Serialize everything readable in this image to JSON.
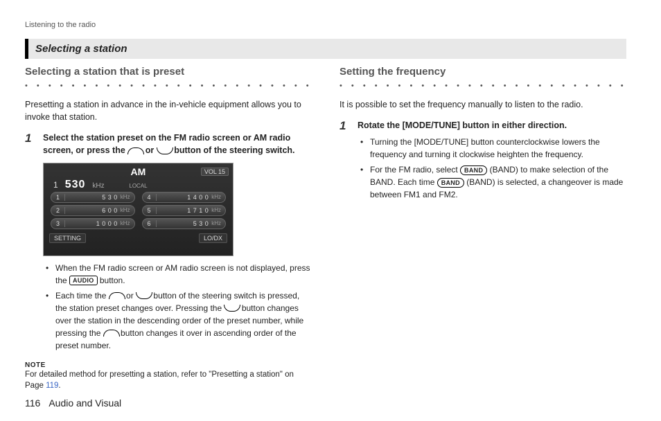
{
  "breadcrumb": "Listening to the radio",
  "section_title": "Selecting a station",
  "left": {
    "subheading": "Selecting a station that is preset",
    "intro": "Presetting a station in advance in the in-vehicle equipment allows you to invoke that station.",
    "step_num": "1",
    "step_a": "Select the station preset on the FM radio screen or AM radio screen, or press the ",
    "step_b": " or ",
    "step_c": " button of the steering switch.",
    "bullet1_a": "When the FM radio screen or AM radio screen is not displayed, press the ",
    "bullet1_b": " button.",
    "bullet2_a": "Each time the ",
    "bullet2_b": " or ",
    "bullet2_c": " button of the steering switch is pressed, the station preset changes over. Pressing the ",
    "bullet2_d": " button changes over the station in the descending order of the preset number, while pressing the ",
    "bullet2_e": " button changes it over in ascending order of the preset number.",
    "note_label": "NOTE",
    "note_a": "For detailed method for presetting a station, refer to \"Presetting a station\" on Page ",
    "note_page": "119",
    "note_b": "."
  },
  "right": {
    "subheading": "Setting the frequency",
    "intro": "It is possible to set the frequency manually to listen to the radio.",
    "step_num": "1",
    "step_text": "Rotate the [MODE/TUNE] button in either direction.",
    "bullet1": "Turning the [MODE/TUNE] button counterclockwise lowers the frequency and turning it clockwise heighten the frequency.",
    "bullet2_a": "For the FM radio, select ",
    "bullet2_b": " (BAND) to make selection of the BAND. Each time ",
    "bullet2_c": " (BAND) is selected, a changeover is made between FM1 and FM2."
  },
  "icons": {
    "audio_label": "AUDIO",
    "band_label": "BAND"
  },
  "radio": {
    "band": "AM",
    "vol": "VOL 15",
    "current_num": "1",
    "current_freq": "530",
    "current_unit": "kHz",
    "local": "LOCAL",
    "presets": [
      {
        "n": "1",
        "f": "5 3 0",
        "u": "kHz"
      },
      {
        "n": "4",
        "f": "1 4 0 0",
        "u": "kHz"
      },
      {
        "n": "2",
        "f": "6 0 0",
        "u": "kHz"
      },
      {
        "n": "5",
        "f": "1 7 1 0",
        "u": "kHz"
      },
      {
        "n": "3",
        "f": "1 0 0 0",
        "u": "kHz"
      },
      {
        "n": "6",
        "f": "5 3 0",
        "u": "kHz"
      }
    ],
    "setting": "SETTING",
    "lodx": "LO/DX"
  },
  "footer": {
    "page": "116",
    "chapter": "Audio and Visual"
  }
}
